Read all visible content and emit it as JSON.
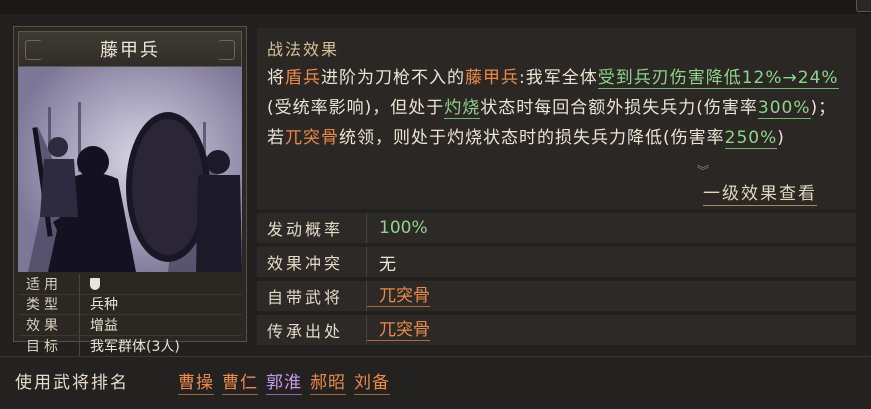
{
  "card": {
    "name": "藤甲兵",
    "info": [
      {
        "key": "适用",
        "value": "",
        "icon": "shield-icon"
      },
      {
        "key": "类型",
        "value": "兵种"
      },
      {
        "key": "效果",
        "value": "增益"
      },
      {
        "key": "目标",
        "value": "我军群体(3人)"
      }
    ]
  },
  "effect": {
    "heading": "战法效果",
    "segments": [
      {
        "text": "将",
        "style": "normal"
      },
      {
        "text": "盾兵",
        "style": "orange"
      },
      {
        "text": "进阶为刀枪不入的",
        "style": "normal"
      },
      {
        "text": "藤甲兵",
        "style": "orange"
      },
      {
        "text": ":我军全体",
        "style": "normal"
      },
      {
        "text": "受到兵刃伤害降低12%→24%",
        "style": "green"
      },
      {
        "text": "(受统率影响)，但处于",
        "style": "normal"
      },
      {
        "text": "灼烧",
        "style": "green"
      },
      {
        "text": "状态时每回合额外损失兵力(伤害率",
        "style": "normal"
      },
      {
        "text": "300%",
        "style": "green"
      },
      {
        "text": ")；若",
        "style": "normal"
      },
      {
        "text": "兀突骨",
        "style": "orange"
      },
      {
        "text": "统领，则处于灼烧状态时的损失兵力降低(伤害率",
        "style": "normal"
      },
      {
        "text": "250%",
        "style": "green"
      },
      {
        "text": ")",
        "style": "normal"
      }
    ],
    "scroll_indicator": "︾",
    "level_link": "一级效果查看"
  },
  "properties": [
    {
      "key": "发动概率",
      "value": "100%",
      "style": "green"
    },
    {
      "key": "效果冲突",
      "value": "无",
      "style": "normal"
    },
    {
      "key": "自带武将",
      "value": "兀突骨",
      "style": "orange"
    },
    {
      "key": "传承出处",
      "value": "兀突骨",
      "style": "orange"
    }
  ],
  "ranking": {
    "label": "使用武将排名",
    "names": [
      {
        "name": "曹操",
        "color": "orange"
      },
      {
        "name": "曹仁",
        "color": "orange"
      },
      {
        "name": "郭淮",
        "color": "purple"
      },
      {
        "name": "郝昭",
        "color": "orange"
      },
      {
        "name": "刘备",
        "color": "orange"
      }
    ]
  },
  "colors": {
    "orange": "#e98a4c",
    "green": "#8fd48a",
    "purple": "#c79ae8"
  }
}
